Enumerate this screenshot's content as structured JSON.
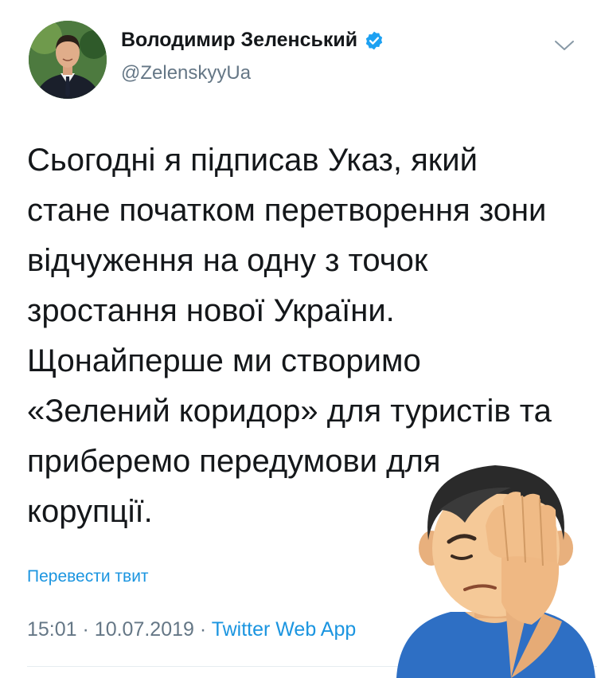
{
  "author": {
    "name": "Володимир Зеленський",
    "handle": "@ZelenskyyUa",
    "avatar_icon": "profile-photo",
    "verified_icon": "verified-badge-icon"
  },
  "tweet": {
    "lines": [
      "Сьогодні я підписав Указ, який",
      "стане початком перетворення зони",
      "відчуження на одну з точок",
      "зростання нової України.",
      "Щонайперше ми створимо",
      "«Зелений коридор» для туристів та",
      "приберемо передумови для",
      "корупції."
    ],
    "translate_label": "Перевести твит",
    "time": "15:01",
    "separator": "·",
    "date": "10.07.2019",
    "source": "Twitter Web App"
  },
  "overlay": {
    "emoji": "facepalm-emoji"
  },
  "colors": {
    "text": "#14171a",
    "secondary": "#657786",
    "link": "#1b95e0",
    "verified": "#1da1f2",
    "divider": "#e6ecf0"
  }
}
